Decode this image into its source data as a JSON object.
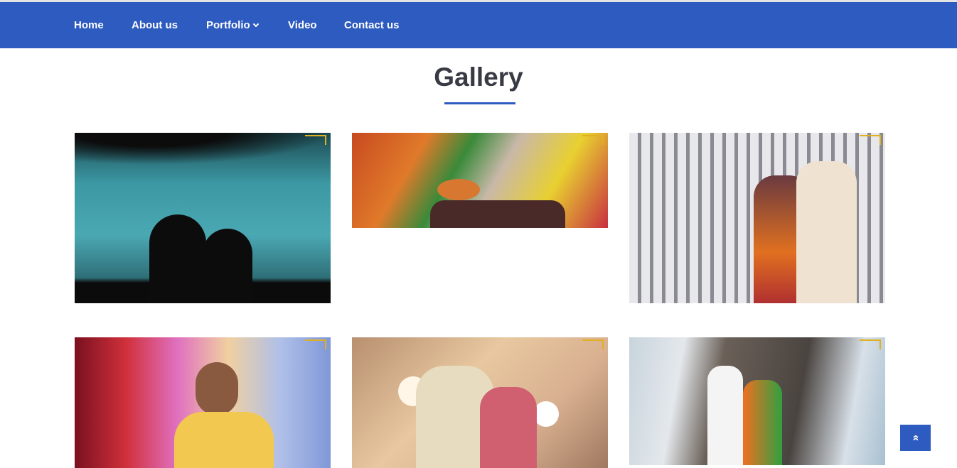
{
  "nav": {
    "items": [
      {
        "label": "Home"
      },
      {
        "label": "About us"
      },
      {
        "label": "Portfolio",
        "has_dropdown": true
      },
      {
        "label": "Video"
      },
      {
        "label": "Contact us"
      }
    ]
  },
  "page_title": "Gallery",
  "colors": {
    "brand": "#2e5bc0",
    "title": "#383a44"
  },
  "gallery": [
    {
      "subject": "silhouette couple at dusk"
    },
    {
      "subject": "diya lamp in hands"
    },
    {
      "subject": "couple by white fence"
    },
    {
      "subject": "groom portrait colorful bokeh"
    },
    {
      "subject": "bride and groom with bokeh lights"
    },
    {
      "subject": "couple exchanging garlands"
    }
  ],
  "scroll_top": {
    "icon": "double-chevron-up-icon",
    "label": "»"
  }
}
